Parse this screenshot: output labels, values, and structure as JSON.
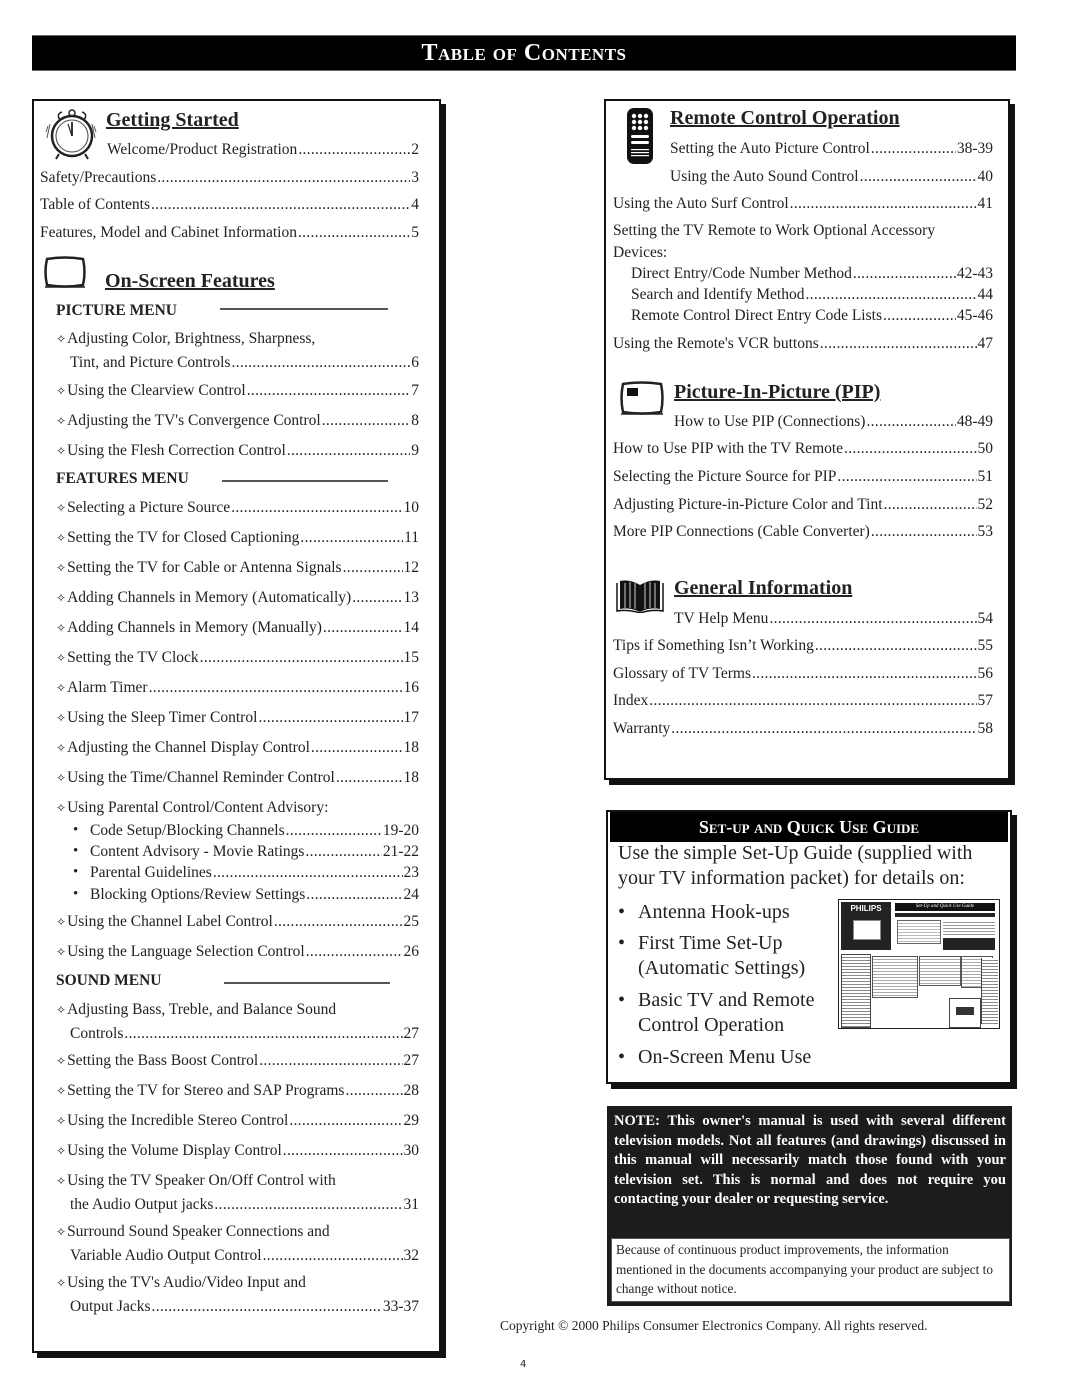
{
  "page_title": "Table of Contents",
  "left_column": {
    "getting_started": {
      "icon": "alarm-clock-icon",
      "title": "Getting Started",
      "entries": [
        {
          "text": "Welcome/Product Registration",
          "page": "2"
        },
        {
          "text": "Safety/Precautions",
          "page": "3"
        },
        {
          "text": "Table of Contents",
          "page": "4"
        },
        {
          "text": "Features, Model and Cabinet Information",
          "page": "5"
        }
      ]
    },
    "on_screen_features": {
      "icon": "tv-screen-icon",
      "title": "On-Screen Features",
      "picture_menu": {
        "label": "PICTURE MENU",
        "entries": [
          {
            "line1": "Adjusting Color, Brightness, Sharpness,",
            "text": "Tint, and Picture Controls",
            "page": "6"
          },
          {
            "text": "Using the Clearview Control",
            "page": "7"
          },
          {
            "text": "Adjusting the TV's Convergence Control",
            "page": "8"
          },
          {
            "text": "Using the Flesh Correction Control",
            "page": "9"
          }
        ]
      },
      "features_menu": {
        "label": "FEATURES MENU",
        "entries": [
          {
            "text": "Selecting a Picture Source",
            "page": "10"
          },
          {
            "text": "Setting the TV for Closed Captioning",
            "page": "11"
          },
          {
            "text": "Setting the TV for Cable or Antenna Signals",
            "page": "12"
          },
          {
            "text": "Adding Channels in Memory (Automatically)",
            "page": "13"
          },
          {
            "text": "Adding Channels in Memory (Manually)",
            "page": "14"
          },
          {
            "text": "Setting the TV Clock",
            "page": "15"
          },
          {
            "text": "Alarm Timer",
            "page": "16"
          },
          {
            "text": "Using the Sleep Timer Control",
            "page": "17"
          },
          {
            "text": "Adjusting the Channel Display Control",
            "page": "18"
          },
          {
            "text": "Using the Time/Channel Reminder Control",
            "page": "18"
          }
        ],
        "parental": {
          "text": "Using Parental Control/Content Advisory:",
          "items": [
            {
              "text": "Code Setup/Blocking Channels",
              "page": "19-20"
            },
            {
              "text": "Content Advisory - Movie Ratings",
              "page": "21-22"
            },
            {
              "text": "Parental Guidelines",
              "page": "23"
            },
            {
              "text": "Blocking Options/Review Settings",
              "page": "24"
            }
          ]
        },
        "after": [
          {
            "text": "Using the Channel Label Control",
            "page": "25"
          },
          {
            "text": "Using the Language Selection Control",
            "page": "26"
          }
        ]
      },
      "sound_menu": {
        "label": "SOUND MENU",
        "entries": [
          {
            "line1": "Adjusting Bass, Treble, and Balance Sound",
            "text": "Controls",
            "page": "27"
          },
          {
            "text": "Setting the Bass Boost Control",
            "page": "27"
          },
          {
            "text": "Setting the TV for Stereo and SAP Programs",
            "page": "28"
          },
          {
            "text": "Using the Incredible Stereo Control",
            "page": "29"
          },
          {
            "text": "Using the Volume Display Control",
            "page": "30"
          },
          {
            "line1": "Using the TV Speaker On/Off Control with",
            "text": "the Audio Output jacks",
            "page": "31"
          },
          {
            "line1": "Surround Sound Speaker Connections and",
            "text": "Variable Audio Output Control",
            "page": "32"
          },
          {
            "line1": "Using the TV's Audio/Video Input and",
            "text": "Output Jacks",
            "page": "33-37"
          }
        ]
      }
    }
  },
  "right_column": {
    "remote_control": {
      "icon": "remote-control-icon",
      "title": "Remote Control Operation",
      "entries": [
        {
          "text": "Setting the Auto Picture Control",
          "page": "38-39"
        },
        {
          "text": "Using the Auto Sound Control",
          "page": "40"
        },
        {
          "text": "Using the Auto Surf Control",
          "page": "41"
        }
      ],
      "accessory_heading_line1": "Setting the TV Remote to Work Optional Accessory",
      "accessory_heading_line2": "Devices:",
      "accessory_entries": [
        {
          "text": "Direct Entry/Code Number Method",
          "page": "42-43"
        },
        {
          "text": "Search and Identify Method",
          "page": "44"
        },
        {
          "text": "Remote Control Direct Entry Code Lists",
          "page": "45-46"
        }
      ],
      "vcr_entry": {
        "text": "Using the Remote's VCR buttons",
        "page": "47"
      }
    },
    "pip": {
      "icon": "pip-screen-icon",
      "title": "Picture-In-Picture (PIP)",
      "entries": [
        {
          "text": "How to Use PIP (Connections)",
          "page": "48-49"
        },
        {
          "text": "How to Use PIP with the TV Remote",
          "page": "50"
        },
        {
          "text": "Selecting the Picture Source for PIP",
          "page": "51"
        },
        {
          "text": "Adjusting Picture-in-Picture Color and Tint",
          "page": "52"
        },
        {
          "text": "More PIP Connections (Cable Converter)",
          "page": "53"
        }
      ]
    },
    "general": {
      "icon": "open-book-icon",
      "title": "General Information",
      "entries": [
        {
          "text": "TV Help Menu",
          "page": "54"
        },
        {
          "text": "Tips if Something Isn’t Working",
          "page": "55"
        },
        {
          "text": "Glossary of TV Terms",
          "page": "56"
        },
        {
          "text": "Index",
          "page": "57"
        },
        {
          "text": "Warranty",
          "page": "58"
        }
      ]
    },
    "setup_guide": {
      "heading": "Set-up and Quick Use Guide",
      "intro_line1": "Use the simple Set-Up Guide (supplied with",
      "intro_line2": "your TV information packet) for details on:",
      "bullets": [
        {
          "line1": "Antenna Hook-ups"
        },
        {
          "line1": "First Time Set-Up",
          "line2": "(Automatic Settings)"
        },
        {
          "line1": "Basic TV and Remote",
          "line2": "Control Operation"
        },
        {
          "line1": "On-Screen Menu Use"
        }
      ],
      "thumbnail_brand": "PHILIPS",
      "thumbnail_title": "Set-Up and Quick Use Guide"
    },
    "note": {
      "text": "NOTE: This owner's manual is used with several different television models. Not all features (and drawings) discussed in this manual will necessarily match those found with your television set. This is normal and does not require you contacting your dealer or requesting service.",
      "subtext": "Because of continuous product improvements, the information mentioned in the documents accompanying your product are subject to change without notice."
    }
  },
  "footer": {
    "copyright": "Copyright © 2000 Philips Consumer Electronics Company. All rights reserved.",
    "page_number": "4"
  },
  "symbols": {
    "diamond": "✧",
    "bullet": "•"
  }
}
